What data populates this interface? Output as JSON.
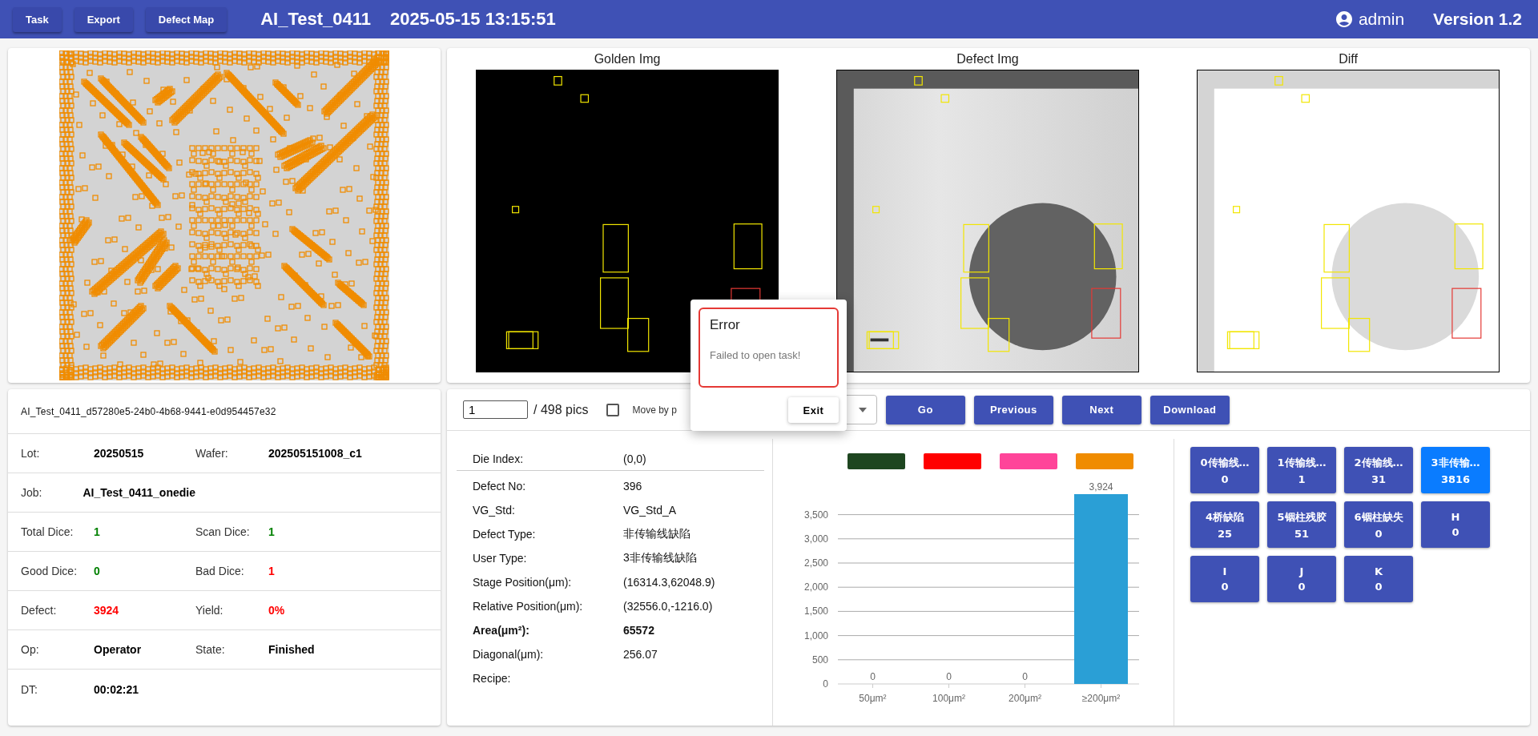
{
  "top_bar": {
    "buttons": [
      "Task",
      "Export",
      "Defect Map"
    ],
    "task_name": "AI_Test_0411",
    "timestamp": "2025-05-15 13:15:51",
    "user": "admin",
    "version": "Version 1.2"
  },
  "image_panels": [
    {
      "title": "Golden Img",
      "kind": "golden"
    },
    {
      "title": "Defect Img",
      "kind": "defect"
    },
    {
      "title": "Diff",
      "kind": "diff"
    }
  ],
  "task_info": {
    "task_id": "AI_Test_0411_d57280e5-24b0-4b68-9441-e0d954457e32",
    "rows": [
      {
        "fields": [
          {
            "label": "Lot:",
            "value": "20250515"
          },
          {
            "label": "Wafer:",
            "value": "202505151008_c1"
          }
        ]
      },
      {
        "fields": [
          {
            "label": "Job:",
            "value": "AI_Test_0411_onedie"
          }
        ]
      },
      {
        "fields": [
          {
            "label": "Total Dice:",
            "value": "1",
            "color": "#008000"
          },
          {
            "label": "Scan Dice:",
            "value": "1",
            "color": "#008000"
          }
        ]
      },
      {
        "fields": [
          {
            "label": "Good Dice:",
            "value": "0",
            "color": "#008000"
          },
          {
            "label": "Bad Dice:",
            "value": "1",
            "color": "#ff0000"
          }
        ]
      },
      {
        "fields": [
          {
            "label": "Defect:",
            "value": "3924",
            "color": "#ff0000"
          },
          {
            "label": "Yield:",
            "value": "0%",
            "color": "#ff0000"
          }
        ]
      },
      {
        "fields": [
          {
            "label": "Op:",
            "value": "Operator"
          },
          {
            "label": "State:",
            "value": "Finished"
          }
        ]
      },
      {
        "fields": [
          {
            "label": "DT:",
            "value": "00:02:21"
          }
        ]
      }
    ]
  },
  "navigator": {
    "page_input": "1",
    "page_total": "/ 498 pics",
    "move_checkbox": {
      "label": "Move by p",
      "checked": false
    },
    "buttons": [
      "Go",
      "Previous",
      "Next",
      "Download"
    ]
  },
  "defect_details": [
    {
      "label": "Die Index:",
      "value": "(0,0)",
      "bold": false
    },
    {
      "label": "Defect No:",
      "value": "396",
      "bold": false
    },
    {
      "label": "VG_Std:",
      "value": "VG_Std_A",
      "bold": false
    },
    {
      "label": "Defect Type:",
      "value": "非传输线缺陷",
      "bold": false
    },
    {
      "label": "User Type:",
      "value": "3非传输线缺陷",
      "bold": false
    },
    {
      "label": "Stage Position(μm):",
      "value": "(16314.3,62048.9)",
      "bold": false
    },
    {
      "label": "Relative Position(μm):",
      "value": "(32556.0,-1216.0)",
      "bold": false
    },
    {
      "label": "Area(μm²):",
      "value": "65572",
      "bold": true
    },
    {
      "label": "Diagonal(μm):",
      "value": "256.07",
      "bold": false
    },
    {
      "label": "Recipe:",
      "bold": false
    }
  ],
  "area_chart": {
    "legend": [
      {
        "color": "#1e4620"
      },
      {
        "color": "#ff0000"
      },
      {
        "color": "#ff4499"
      },
      {
        "color": "#f08c00"
      }
    ],
    "chart_data": {
      "type": "bar",
      "categories": [
        "50μm²",
        "100μm²",
        "200μm²",
        "≥200μm²"
      ],
      "series": [
        {
          "color": "#2a9fd6",
          "values": [
            0,
            0,
            0,
            3924
          ]
        }
      ],
      "yticks": [
        0,
        500,
        {
          "value": 1000,
          "label": "1,000"
        },
        {
          "value": 1500,
          "label": "1,500"
        },
        {
          "value": 2000,
          "label": "2,000"
        },
        {
          "value": 2500,
          "label": "2,500"
        },
        {
          "value": 3000,
          "label": "3,000"
        },
        {
          "value": 3500,
          "label": "3,500"
        }
      ],
      "ylim": [
        0,
        3924
      ],
      "grid": true,
      "value_labels": [
        "0",
        "0",
        "0",
        "3,924"
      ]
    }
  },
  "defect_classes": [
    {
      "label": "0传输线…",
      "count": "0",
      "selected": false
    },
    {
      "label": "1传输线…",
      "count": "1",
      "selected": false
    },
    {
      "label": "2传输线…",
      "count": "31",
      "selected": false
    },
    {
      "label": "3非传输…",
      "count": "3816",
      "selected": true
    },
    {
      "label": "4桥缺陷",
      "count": "25",
      "selected": false
    },
    {
      "label": "5铟柱残胶",
      "count": "51",
      "selected": false
    },
    {
      "label": "6铟柱缺失",
      "count": "0",
      "selected": false
    },
    {
      "label": "H",
      "count": "0",
      "selected": false
    },
    {
      "label": "I",
      "count": "0",
      "selected": false
    },
    {
      "label": "J",
      "count": "0",
      "selected": false
    },
    {
      "label": "K",
      "count": "0",
      "selected": false
    }
  ],
  "error_dialog": {
    "title": "Error",
    "message": "Failed to open task!",
    "button": "Exit"
  }
}
